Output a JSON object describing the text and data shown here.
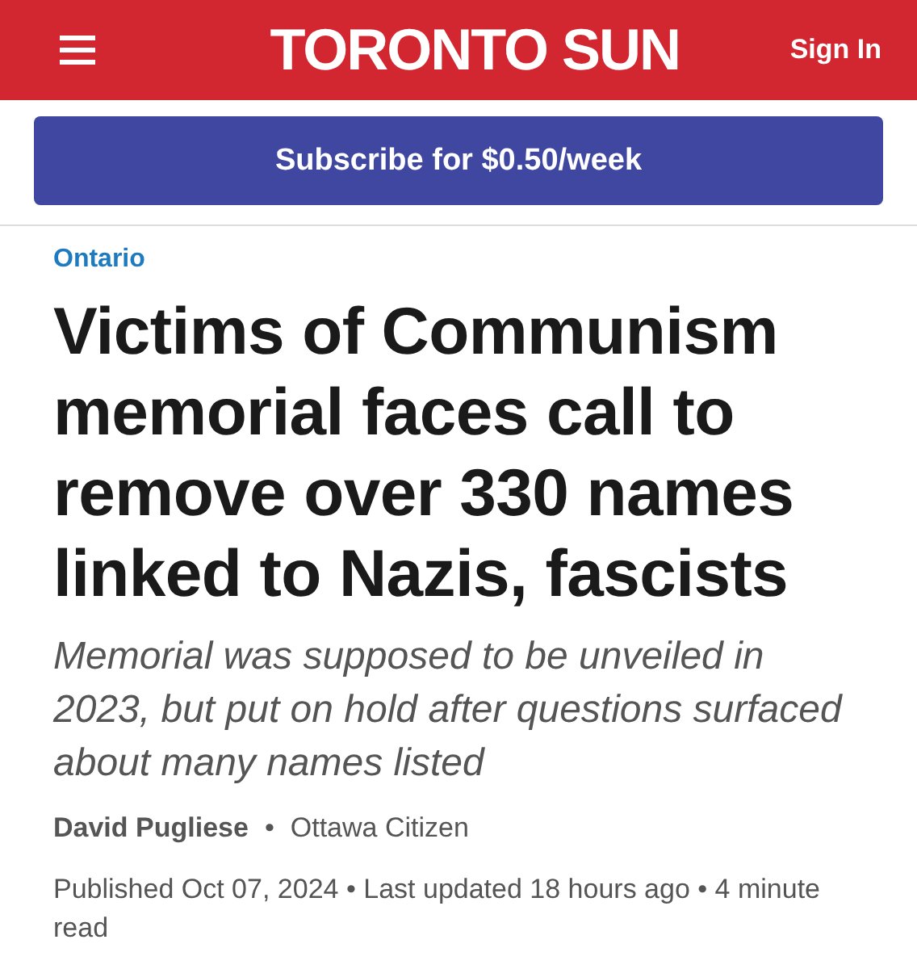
{
  "header": {
    "logo_light": "TORONTO",
    "logo_bold": "SUN",
    "sign_in": "Sign In"
  },
  "subscribe_button": "Subscribe for $0.50/week",
  "article": {
    "section": "Ontario",
    "headline": "Victims of Communism memorial faces call to remove over 330 names linked to Nazis, fascists",
    "deck": "Memorial was supposed to be unveiled in 2023, but put on hold after questions surfaced about many names listed",
    "author": "David Pugliese",
    "separator": "•",
    "source": "Ottawa Citizen",
    "meta": "Published Oct 07, 2024 • Last updated 18 hours ago • 4 minute read"
  }
}
